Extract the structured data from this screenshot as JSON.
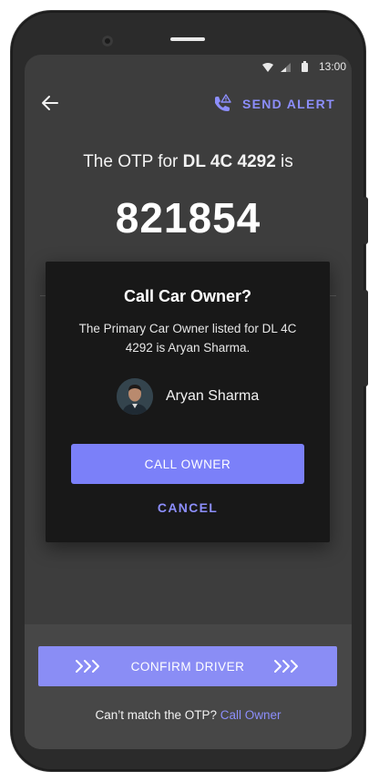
{
  "status_bar": {
    "time": "13:00",
    "icons": [
      "wifi-icon",
      "signal-icon",
      "battery-icon"
    ]
  },
  "header": {
    "back_icon": "arrow-left-icon",
    "send_alert_icon": "phone-alert-icon",
    "send_alert_label": "SEND ALERT"
  },
  "otp": {
    "prefix": "The OTP for ",
    "vehicle": "DL 4C 4292",
    "suffix": " is",
    "code": "821854"
  },
  "dialog": {
    "title": "Call Car Owner?",
    "body": "The Primary Car Owner listed for DL 4C 4292 is Aryan Sharma.",
    "owner_name": "Aryan Sharma",
    "call_button": "CALL OWNER",
    "cancel_button": "CANCEL"
  },
  "footer": {
    "confirm_label": "CONFIRM DRIVER",
    "chevron_icon": "triple-chevron-right-icon",
    "mismatch_text": "Can’t match the OTP? ",
    "mismatch_link": "Call Owner"
  },
  "colors": {
    "accent": "#8c8efb",
    "button": "#7b80f9",
    "screen_bg": "#3d3d3d",
    "dialog_bg": "#181818"
  }
}
